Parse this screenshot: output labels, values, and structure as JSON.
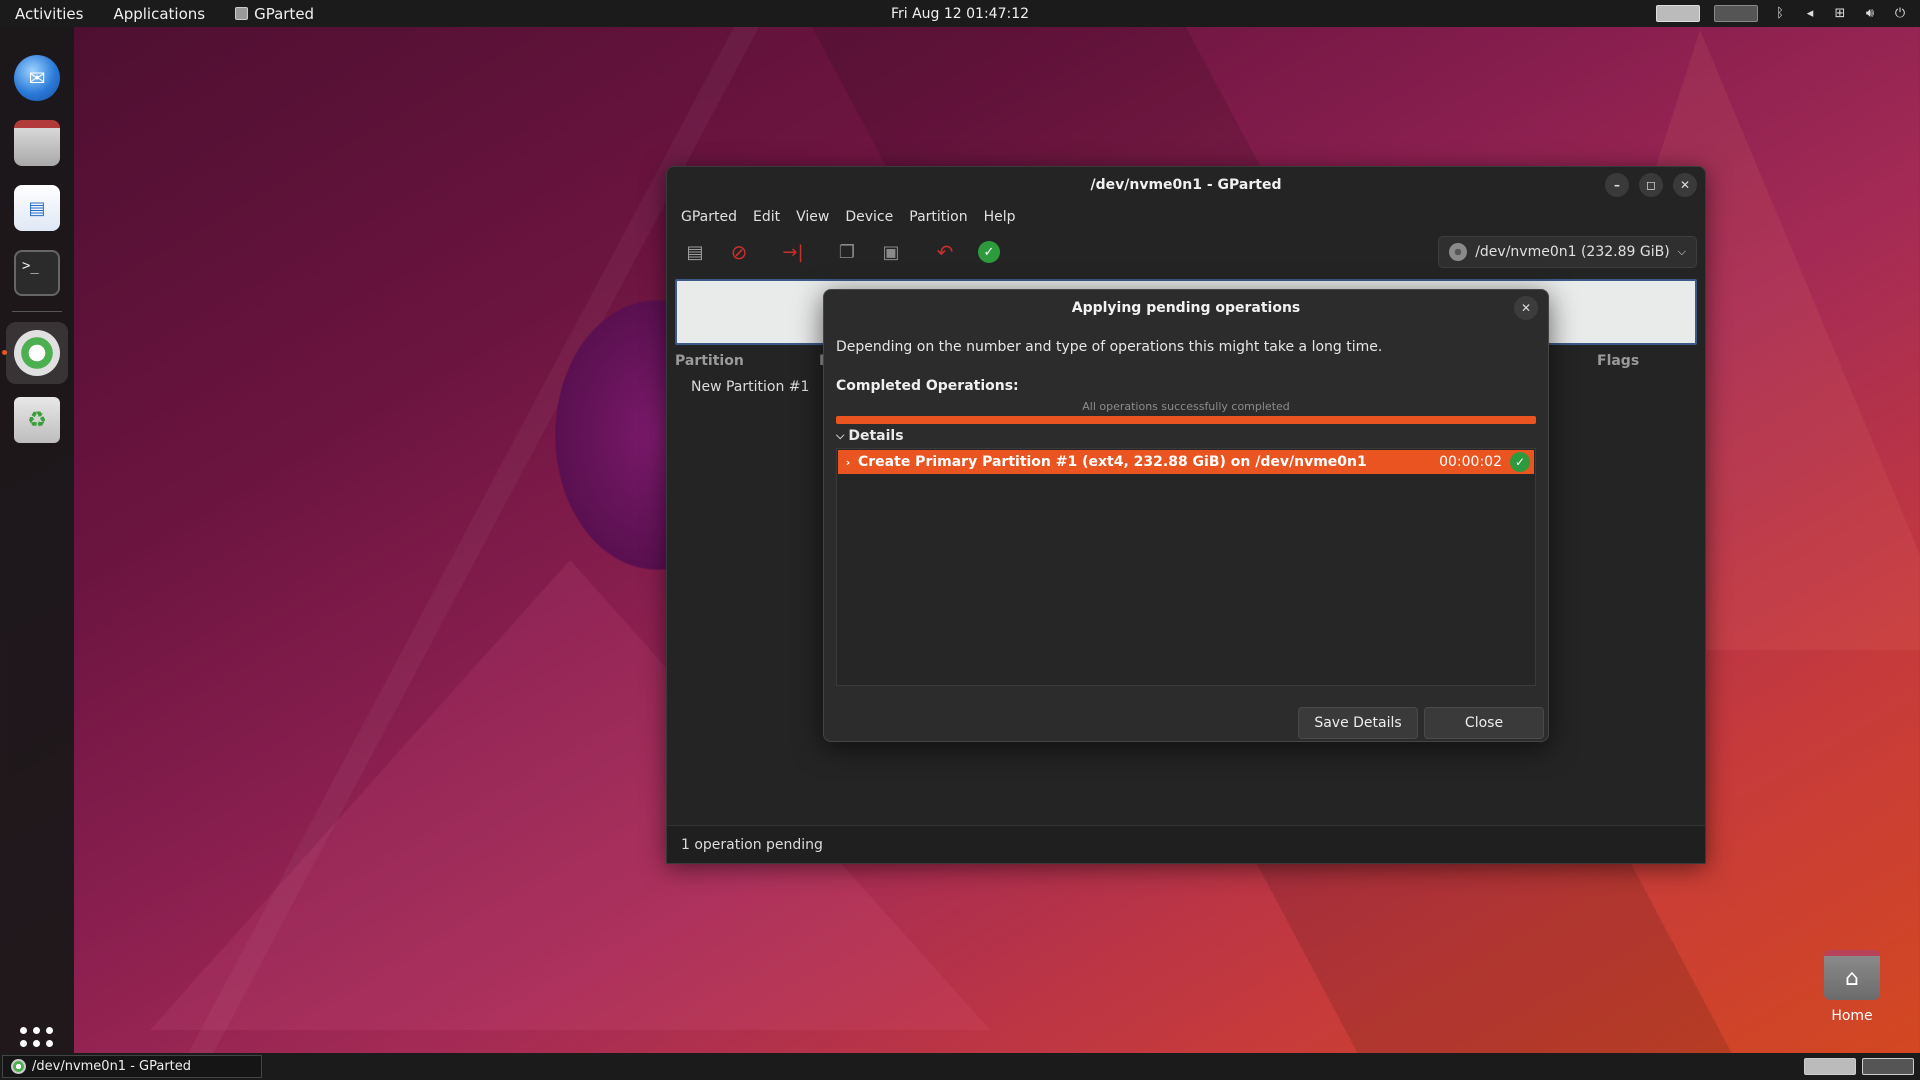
{
  "topbar": {
    "activities": "Activities",
    "applications": "Applications",
    "app_name": "GParted",
    "clock": "Fri Aug 12  01:47:12"
  },
  "dock": {
    "items": [
      "thunderbird-icon",
      "files-icon",
      "writer-icon",
      "terminal-icon",
      "gparted-icon",
      "trash-icon"
    ]
  },
  "desktop": {
    "home_label": "Home"
  },
  "taskbar": {
    "window_label": "/dev/nvme0n1 - GParted"
  },
  "window": {
    "title": "/dev/nvme0n1 - GParted",
    "menu": [
      "GParted",
      "Edit",
      "View",
      "Device",
      "Partition",
      "Help"
    ],
    "device_selector": "/dev/nvme0n1  (232.89 GiB)",
    "columns": {
      "partition": "Partition",
      "filesystem": "F",
      "flags": "Flags"
    },
    "partition_row": "New Partition #1",
    "status": "1 operation pending"
  },
  "dialog": {
    "title": "Applying pending operations",
    "message": "Depending on the number and type of operations this might take a long time.",
    "completed_label": "Completed Operations:",
    "progress_text": "All operations successfully completed",
    "progress_fraction": 1.0,
    "details_label": "Details",
    "operation": {
      "label": "Create Primary Partition #1 (ext4, 232.88 GiB) on /dev/nvme0n1",
      "time": "00:00:02"
    },
    "save_button": "Save Details",
    "close_button": "Close"
  },
  "colors": {
    "accent": "#e95420",
    "success": "#2e9a3e"
  }
}
